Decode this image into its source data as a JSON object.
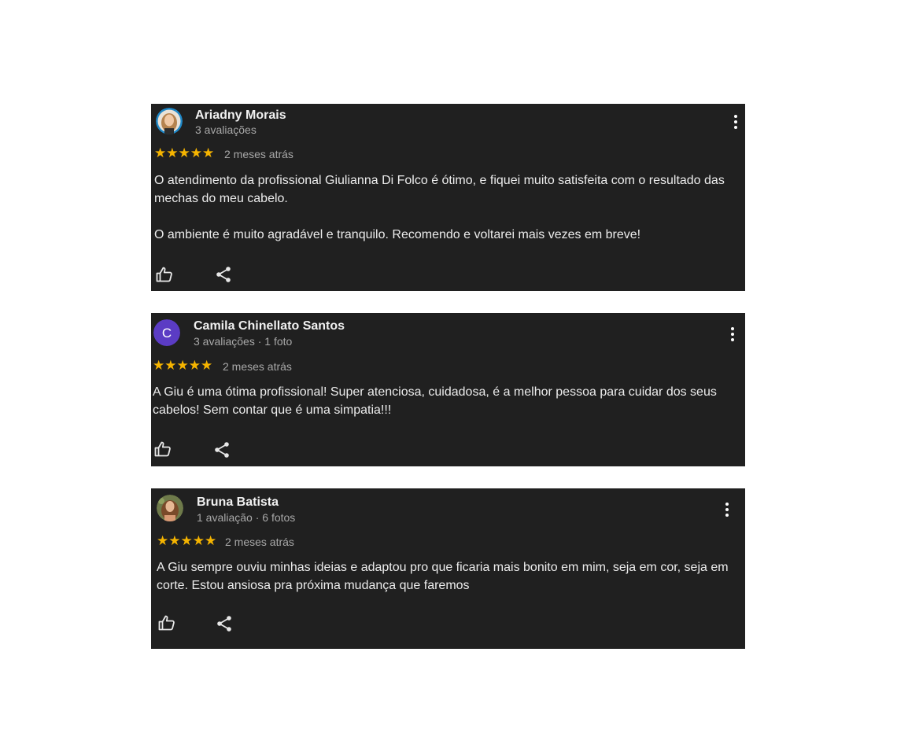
{
  "reviews": [
    {
      "author": "Ariadny Morais",
      "meta": "3 avaliações",
      "rating": 5,
      "stars": "★★★★★",
      "time": "2 meses atrás",
      "paragraphs": [
        "O atendimento da profissional Giulianna Di Folco é ótimo, e fiquei muito satisfeita com o resultado das mechas do meu cabelo.",
        "O ambiente é muito agradável e tranquilo. Recomendo e voltarei mais vezes em breve!"
      ],
      "avatar": {
        "type": "photo",
        "ring_color": "#1e88c8"
      }
    },
    {
      "author": "Camila Chinellato Santos",
      "meta": "3 avaliações · 1 foto",
      "rating": 5,
      "stars": "★★★★★",
      "time": "2 meses atrás",
      "paragraphs": [
        "A Giu é uma ótima profissional! Super atenciosa, cuidadosa, é a melhor pessoa para cuidar dos seus cabelos! Sem contar que é uma simpatia!!!"
      ],
      "avatar": {
        "type": "letter",
        "letter": "C",
        "color": "#5b3cc4"
      }
    },
    {
      "author": "Bruna Batista",
      "meta": "1 avaliação · 6 fotos",
      "rating": 5,
      "stars": "★★★★★",
      "time": "2 meses atrás",
      "paragraphs": [
        "A Giu sempre ouviu minhas ideias e adaptou pro que ficaria mais bonito em mim, seja em cor, seja em corte. Estou ansiosa pra próxima mudança que faremos"
      ],
      "avatar": {
        "type": "photo"
      }
    }
  ],
  "colors": {
    "card_background": "#202020",
    "star": "#f5b400",
    "secondary_text": "#a8a8a8"
  },
  "icons": [
    "thumbs-up-icon",
    "share-icon",
    "more-vert-icon"
  ]
}
